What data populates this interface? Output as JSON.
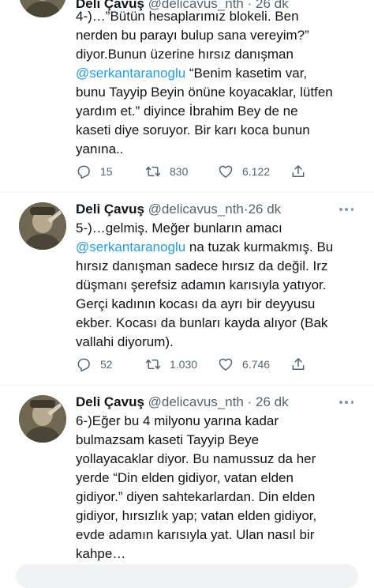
{
  "tweets": [
    {
      "author_name": "Deli Çavuş",
      "author_handle": "@delicavus_nth",
      "dot": "·",
      "time": "26 dk",
      "lines": [
        {
          "text": "4-)…”Bütün hesaplarımız blokeli. Ben"
        },
        {
          "text": "nerden bu parayı bulup sana vereyim?”"
        },
        {
          "text": "diyor.Bunun üzerine hırsız danışman"
        },
        {
          "mention": "@serkantaranoglu",
          "text": " “Benim kasetim var,"
        },
        {
          "text": "bunu Tayyip Beyin önüne koyacaklar, lütfen"
        },
        {
          "text": "yardım et.”  diyince İbrahim Bey de ne"
        },
        {
          "text": "kaseti diye soruyor. Bir karı koca bunun"
        },
        {
          "text": "yanına.."
        }
      ],
      "replies": "15",
      "retweets": "830",
      "likes": "6.122"
    },
    {
      "author_name": "Deli Çavuş",
      "author_handle": "@delicavus_nth",
      "dot": "·",
      "time": "26 dk",
      "lines": [
        {
          "text": "5-)…gelmiş. Meğer bunların amacı"
        },
        {
          "mention": "@serkantaranoglu",
          "text": " na tuzak kurmakmış. Bu"
        },
        {
          "text": "hırsız danışman sadece hırsız da değil. Irz"
        },
        {
          "text": "düşmanı şerefsiz adamın karısıyla yatıyor."
        },
        {
          "text": "Gerçi kadının kocası da ayrı bir deyyusu"
        },
        {
          "text": "ekber. Kocası da bunları kayda alıyor (Bak"
        },
        {
          "text": "vallahi diyorum)."
        }
      ],
      "replies": "52",
      "retweets": "1.030",
      "likes": "6.746"
    },
    {
      "author_name": "Deli Çavuş",
      "author_handle": "@delicavus_nth",
      "dot": "·",
      "time": "26 dk",
      "lines": [
        {
          "text": "6-)Eğer bu 4 milyonu yarına kadar"
        },
        {
          "text": "bulmazsam kaseti Tayyip Beye"
        },
        {
          "text": "yollayacaklar diyor. Bu namussuz da her"
        },
        {
          "text": "yerde “Din elden gidiyor, vatan elden"
        },
        {
          "text": "gidiyor.” diyen sahtekarlardan. Din elden"
        },
        {
          "text": "gidiyor, hırsızlık yap; vatan elden gidiyor,"
        },
        {
          "text": "evde adamın karısıyla yat. Ulan nasıl bir"
        },
        {
          "text": "kahpe…"
        }
      ]
    }
  ],
  "icons": {
    "reply": "reply-icon",
    "retweet": "retweet-icon",
    "like": "heart-icon",
    "share": "share-icon",
    "more": "more-icon"
  },
  "colors": {
    "mention": "#1d9bf0",
    "secondary_text": "#536471",
    "divider": "#eff3f4"
  }
}
